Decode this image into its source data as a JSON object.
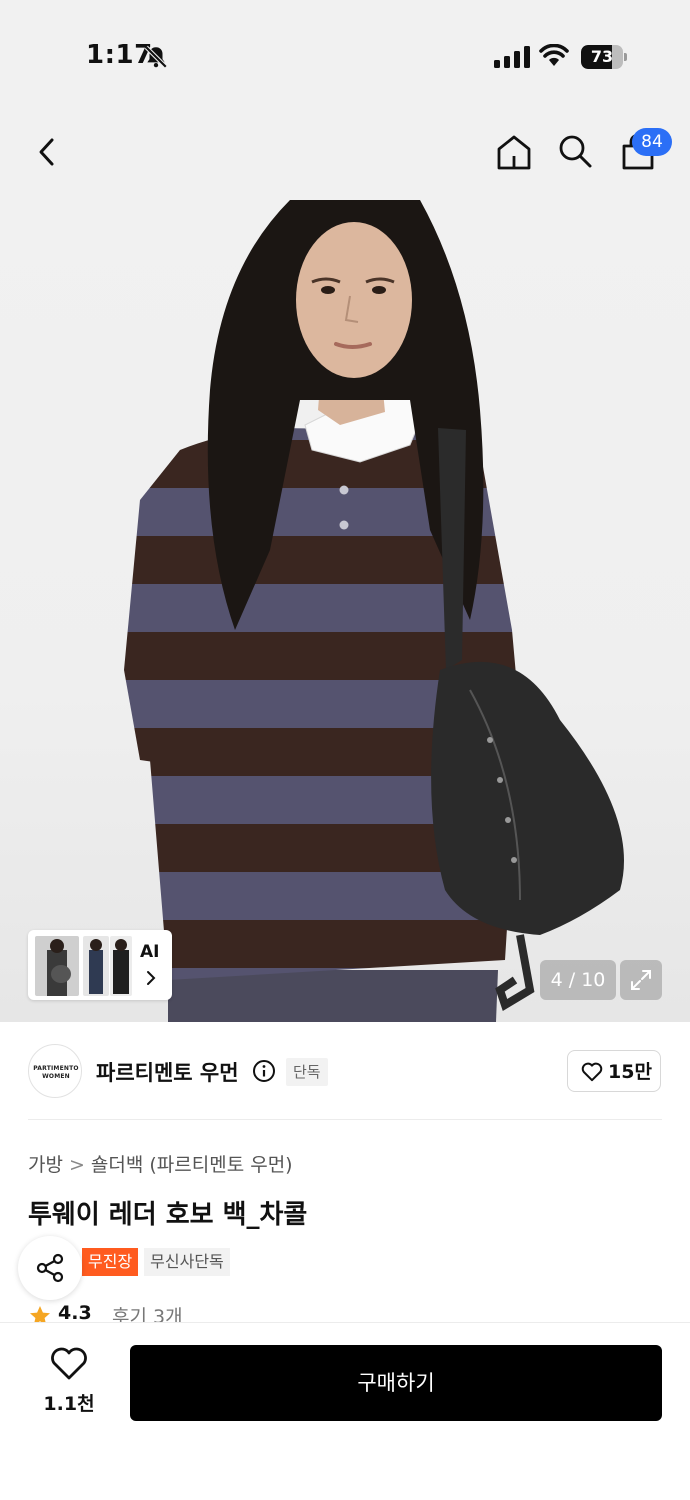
{
  "status_bar": {
    "time": "1:17",
    "battery_level": "73",
    "icons": [
      "bell-slash-icon",
      "signal-icon",
      "wifi-icon",
      "battery-icon"
    ]
  },
  "header": {
    "cart_badge": "84",
    "icons": [
      "back-chevron-icon",
      "home-icon",
      "search-icon",
      "shopping-bag-icon"
    ]
  },
  "gallery": {
    "ai_label": "AI",
    "page_indicator": "4 / 10",
    "current_page": 4,
    "total_pages": 10
  },
  "brand": {
    "logo_line1": "PARTIMENTO",
    "logo_line2": "WOMEN",
    "name": "파르티멘토 우먼",
    "exclusive_tag": "단독",
    "like_count": "15만"
  },
  "product": {
    "breadcrumb": [
      "가방",
      "숄더백 (파르티멘토 우먼)"
    ],
    "title": "투웨이 레더 호보 백_차콜",
    "tags": [
      "무진장",
      "무신사단독"
    ],
    "rating": "4.3",
    "review_label": "후기 3개"
  },
  "bottom_bar": {
    "wish_count": "1.1천",
    "buy_label": "구매하기"
  },
  "colors": {
    "accent_blue": "#2b6ff6",
    "tag_orange": "#ff5b1f",
    "star": "#f5a623",
    "stripe_purple": "#55536f",
    "stripe_brown": "#3a2620"
  }
}
